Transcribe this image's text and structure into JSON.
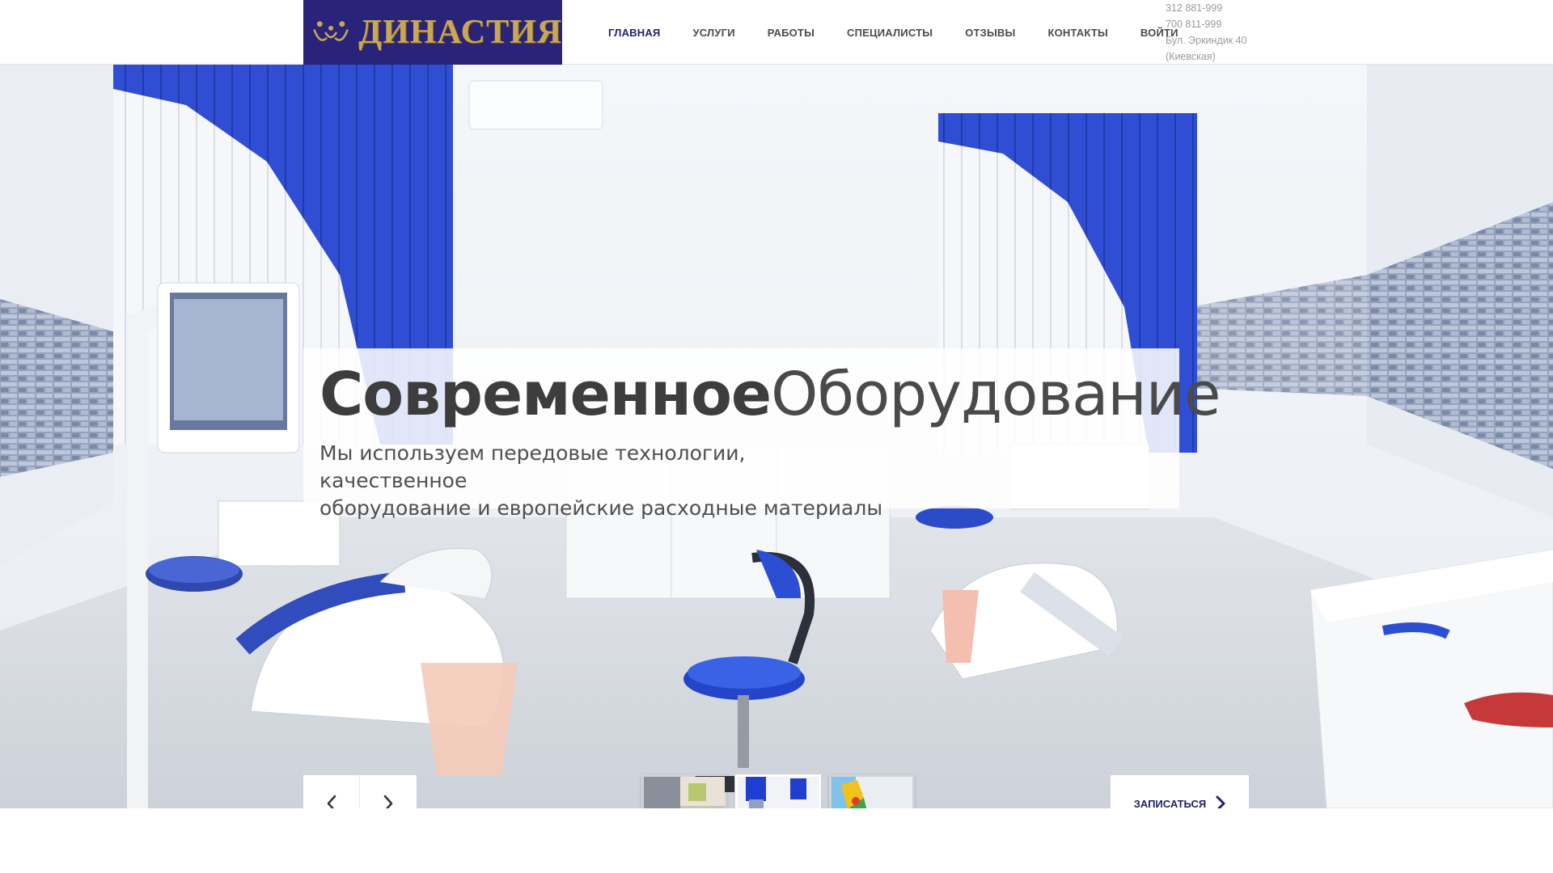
{
  "header": {
    "logo_text": "ДИНАСТИЯ",
    "brand_color": "#2a237a",
    "logo_color": "#c8a856",
    "nav": [
      {
        "label": "ГЛАВНАЯ",
        "active": true
      },
      {
        "label": "УСЛУГИ",
        "active": false
      },
      {
        "label": "РАБОТЫ",
        "active": false
      },
      {
        "label": "СПЕЦИАЛИСТЫ",
        "active": false
      },
      {
        "label": "ОТЗЫВЫ",
        "active": false
      },
      {
        "label": "КОНТАКТЫ",
        "active": false
      },
      {
        "label": "ВОЙТИ",
        "active": false
      }
    ],
    "contacts": {
      "phone1": "312 881-999",
      "phone2": "700 811-999",
      "address1": "Бул. Эркиндик 40",
      "address2": "(Киевская)"
    }
  },
  "hero": {
    "title_bold": "Современное",
    "title_light": "Оборудование",
    "subtitle_line1": "Мы используем передовые технологии, качественное",
    "subtitle_line2": "оборудование и европейские расходные материалы",
    "image_alt": "dental-clinic-interior",
    "prev_icon": "chevron-left-icon",
    "next_icon": "chevron-right-icon",
    "thumbnails": [
      {
        "name": "reception-thumbnail",
        "active": false
      },
      {
        "name": "dental-room-thumbnail",
        "active": true
      },
      {
        "name": "kids-room-thumbnail",
        "active": false
      }
    ],
    "cta_label": "ЗАПИСАТЬСЯ",
    "cta_icon": "chevron-right-icon"
  }
}
